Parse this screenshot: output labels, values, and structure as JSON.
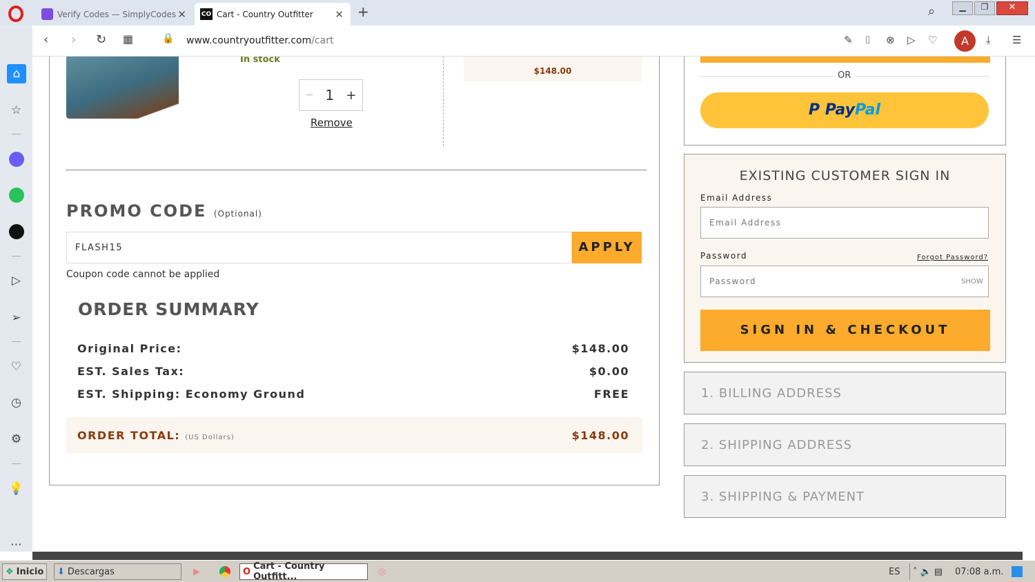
{
  "browser": {
    "tabs": [
      {
        "label": "Verify Codes — SimplyCodes",
        "active": false
      },
      {
        "label": "Cart - Country Outfitter",
        "active": true
      }
    ],
    "url_host": "www.countryoutfitter.com",
    "url_path": "/cart",
    "profile_initial": "A",
    "accent": "#c0392b"
  },
  "cart_item": {
    "stock": "In stock",
    "quantity": "1",
    "minus": "−",
    "plus": "+",
    "remove": "Remove",
    "price": "$148.00"
  },
  "promo": {
    "title": "PROMO CODE",
    "optional": "(Optional)",
    "value": "FLASH15",
    "apply": "APPLY",
    "error": "Coupon code cannot be applied"
  },
  "summary": {
    "title": "ORDER SUMMARY",
    "rows": [
      {
        "label": "Original Price:",
        "value": "$148.00"
      },
      {
        "label": "EST. Sales Tax:",
        "value": "$0.00"
      },
      {
        "label": "EST. Shipping: Economy Ground",
        "value": "FREE"
      }
    ],
    "total_label": "ORDER TOTAL:",
    "total_currency": "(US Dollars)",
    "total_value": "$148.00"
  },
  "checkout": {
    "or": "OR",
    "paypal_pay": "Pay",
    "paypal_pal": "Pal",
    "signin_title": "EXISTING CUSTOMER SIGN IN",
    "email_label": "Email Address",
    "email_placeholder": "Email Address",
    "password_label": "Password",
    "forgot": "Forgot Password?",
    "password_placeholder": "Password",
    "show": "SHOW",
    "signin_button": "SIGN IN & CHECKOUT",
    "steps": [
      "1. BILLING ADDRESS",
      "2. SHIPPING ADDRESS",
      "3. SHIPPING & PAYMENT"
    ],
    "button_color": "#fcab2c"
  },
  "taskbar": {
    "start": "Inicio",
    "downloads": "Descargas",
    "active_window": "Cart - Country Outfitt...",
    "lang": "ES",
    "time": "07:08 a.m."
  }
}
